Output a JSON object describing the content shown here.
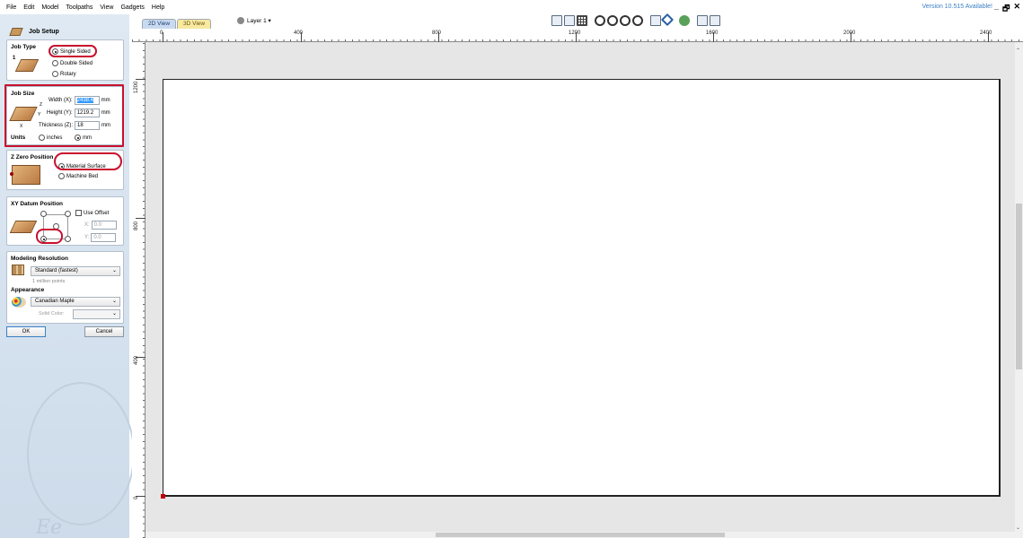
{
  "menu": [
    "File",
    "Edit",
    "Model",
    "Toolpaths",
    "View",
    "Gadgets",
    "Help"
  ],
  "version_text": "Version 10.515 Available!",
  "window_buttons": [
    "_",
    "🗗",
    "✕"
  ],
  "panel": {
    "title": "Job Setup",
    "job_type": {
      "label": "Job Type",
      "marker": "1",
      "options": [
        "Single Sided",
        "Double Sided",
        "Rotary"
      ],
      "selected": "Single Sided"
    },
    "job_size": {
      "label": "Job Size",
      "width_label": "Width (X):",
      "width_value": "2438.4",
      "height_label": "Height (Y):",
      "height_value": "1219.2",
      "thickness_label": "Thickness (Z):",
      "thickness_value": "18",
      "unit": "mm",
      "units_label": "Units",
      "units_options": [
        "inches",
        "mm"
      ],
      "units_selected": "mm",
      "axis_z": "Z",
      "axis_y": "Y",
      "axis_x": "X"
    },
    "z_zero": {
      "label": "Z Zero Position",
      "options": [
        "Material Surface",
        "Machine Bed"
      ],
      "selected": "Material Surface"
    },
    "xy_datum": {
      "label": "XY Datum Position",
      "use_offset_label": "Use Offset",
      "x_label": "X:",
      "x_value": "0.0",
      "y_label": "Y:",
      "y_value": "0.0"
    },
    "modeling": {
      "label": "Modeling Resolution",
      "value": "Standard (fastest)",
      "hint": "1 million points"
    },
    "appearance": {
      "label": "Appearance",
      "value": "Canadian Maple",
      "solid_color_label": "Solid Color:"
    },
    "ok_label": "OK",
    "cancel_label": "Cancel"
  },
  "tabs": [
    "2D View",
    "3D View"
  ],
  "layer_label": "Layer 1 ▾",
  "ruler_h_labels": [
    "0",
    "400",
    "800",
    "1200",
    "1600",
    "2000",
    "2400"
  ],
  "ruler_v_labels": [
    "1200",
    "800",
    "400",
    "0"
  ],
  "colors": {
    "highlight_red": "#c8102e",
    "version_blue": "#3b7fc4",
    "panel_bg": "#d4e1ee",
    "origin_marker": "#c00000"
  }
}
